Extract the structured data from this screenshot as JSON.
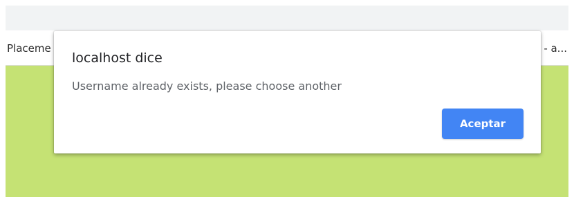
{
  "browser": {
    "tab_left_title": "Placeme",
    "tab_right_title": "- a..."
  },
  "dialog": {
    "title": "localhost dice",
    "message": "Username already exists, please choose another",
    "ok_label": "Aceptar"
  },
  "colors": {
    "page_background": "#c5e274",
    "button_accent": "#4285f4",
    "toolbar": "#f1f3f4"
  }
}
